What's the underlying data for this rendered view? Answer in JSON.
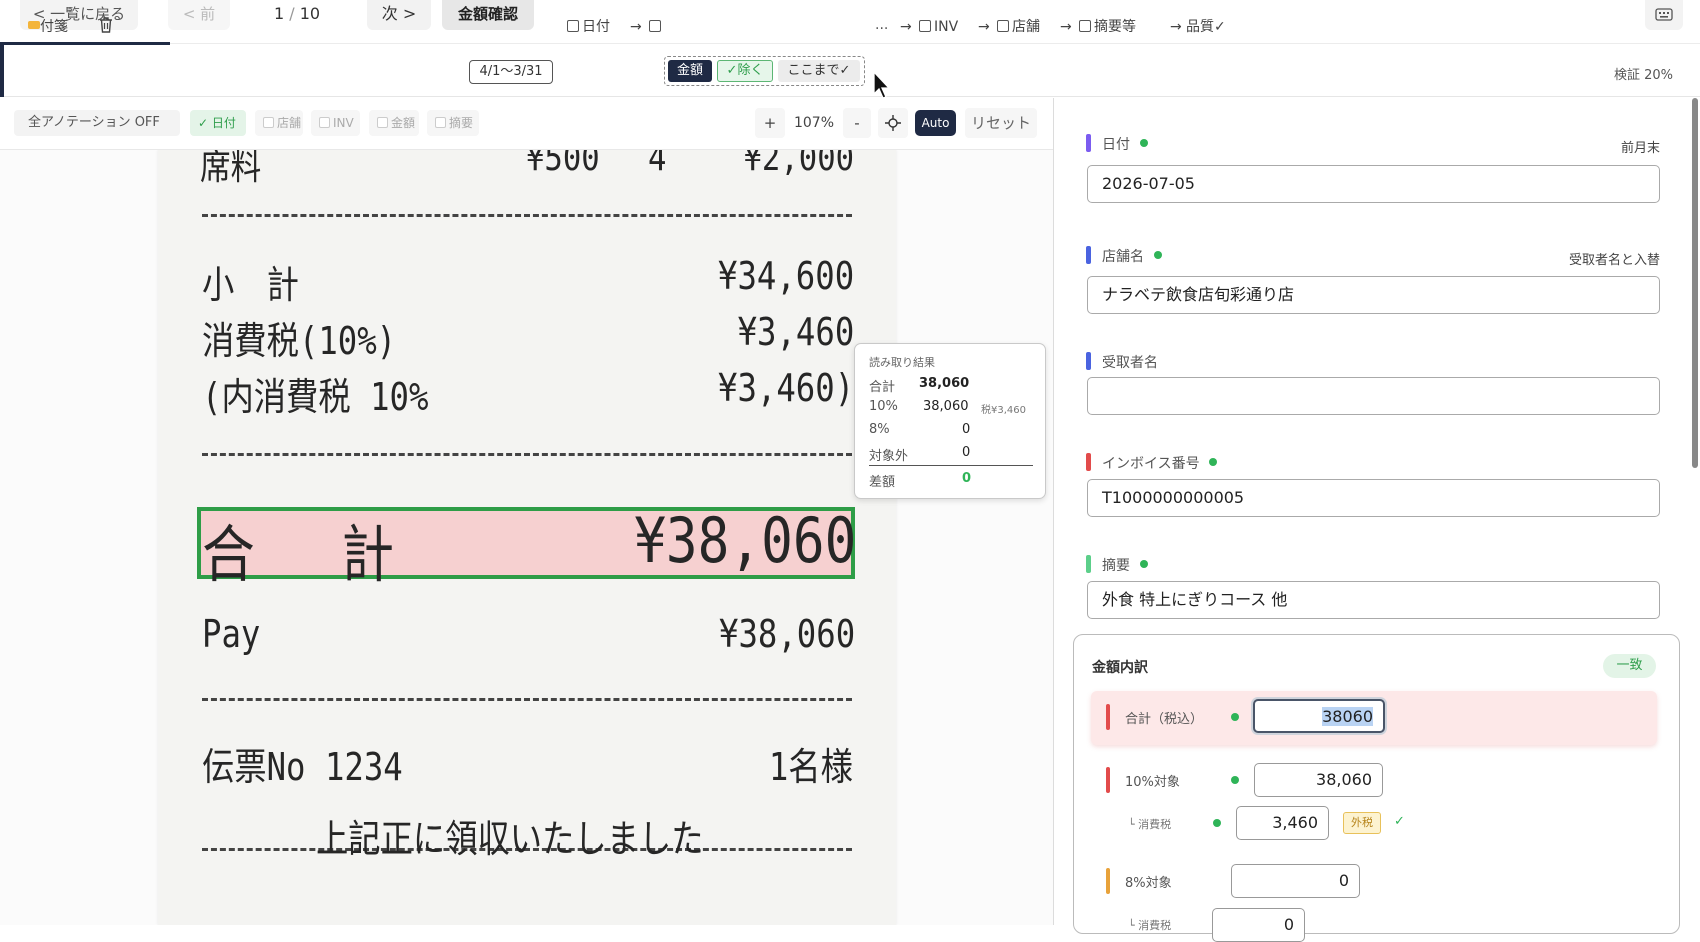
{
  "topbar": {
    "back_label": "< 一覧に戻る",
    "prev_label": "< 前",
    "page_current": "1",
    "page_sep": "/",
    "page_total": "10",
    "next_label": "次 >",
    "confirm_label": "金額確認",
    "keyboard_icon": "keyboard-icon"
  },
  "workflow": {
    "sticky_label": "付箋",
    "trash_icon": "trash-icon",
    "period_label": "4/1〜3/31",
    "date_label": "日付",
    "arrow": "→",
    "amount_chip": "金額",
    "exclude_chip": "✓除く",
    "upto_chip": "ここまで✓",
    "ellipsis": "...",
    "inv_label": "INV",
    "store_label": "店舗",
    "summary_label": "摘要等",
    "quality_label": "品質✓",
    "verify_label": "検証 20%"
  },
  "annot": {
    "all_label": "全アノテーション OFF",
    "date_label": "日付",
    "store_label": "店舗",
    "inv_label": "INV",
    "amount_label": "金額",
    "summary_label": "摘要",
    "zoom_in": "+",
    "zoom_level": "107%",
    "zoom_out": "-",
    "center_icon": "crosshair-icon",
    "auto_label": "Auto",
    "reset_label": "リセット"
  },
  "receipt": {
    "top_item": "席料",
    "top_price": "¥500",
    "top_qty": "4",
    "top_total": "¥2,000",
    "subtotal_label": "小　計",
    "subtotal_value": "¥34,600",
    "tax_label": "消費税(10%)",
    "tax_value": "¥3,460",
    "inner_tax_label": "(内消費税 10%",
    "inner_tax_value": "¥3,460)",
    "total_label": "合　計",
    "total_value": "¥38,060",
    "pay_label": "Pay",
    "pay_value": "¥38,060",
    "slip_label": "伝票No 1234",
    "guests": "1名様",
    "footer": "上記正に領収いたしました"
  },
  "readout": {
    "title": "読み取り結果",
    "rows": [
      {
        "label": "合計",
        "value": "38,060",
        "extra": ""
      },
      {
        "label": "10%",
        "value": "38,060",
        "extra": "税¥3,460"
      },
      {
        "label": "8%",
        "value": "0",
        "extra": ""
      },
      {
        "label": "対象外",
        "value": "0",
        "extra": ""
      }
    ],
    "diff_label": "差額",
    "diff_value": "0"
  },
  "form": {
    "date": {
      "label": "日付",
      "note": "前月末",
      "value": "2026-07-05"
    },
    "store": {
      "label": "店舗名",
      "note": "受取者名と入替",
      "value": "ナラベテ飲食店旬彩通り店"
    },
    "recipient": {
      "label": "受取者名",
      "value": ""
    },
    "invoice": {
      "label": "インボイス番号",
      "value": "T1000000000005"
    },
    "summary": {
      "label": "摘要",
      "value": "外食 特上にぎりコース 他"
    },
    "breakdown": {
      "title": "金額内訳",
      "badge": "一致",
      "total_label": "合計（税込）",
      "total_value": "38060",
      "r10_label": "10%対象",
      "r10_value": "38,060",
      "tax_label": "└ 消費税",
      "tax_value": "3,460",
      "outer_badge": "外税",
      "check": "✓",
      "r8_label": "8%対象",
      "r8_value": "0",
      "tax8_label": "└ 消費税",
      "tax8_value": "0"
    }
  },
  "colors": {
    "navy": "#1f2a44",
    "green": "#2fb458",
    "date_bar": "#7b5cf0",
    "store_bar": "#4a63e0",
    "invoice_bar": "#e24b4b",
    "summary_bar": "#5ccf8a",
    "total_bar": "#e24b4b",
    "r8_bar": "#e8a23a"
  }
}
